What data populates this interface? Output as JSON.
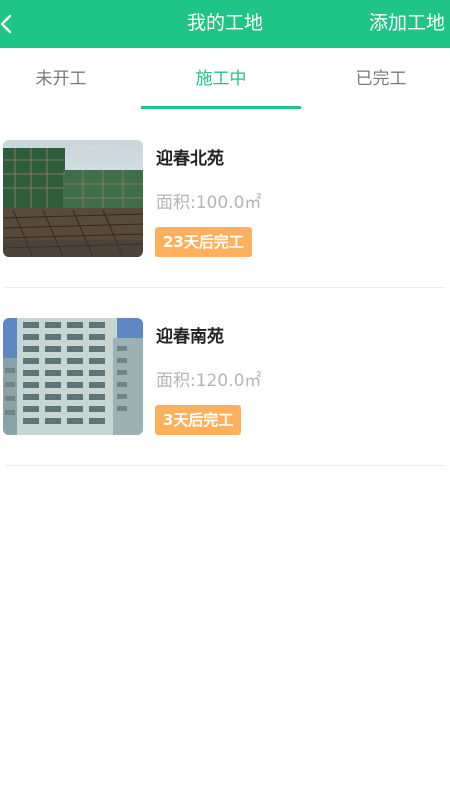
{
  "header": {
    "title": "我的工地",
    "add_label": "添加工地",
    "background": "#1fc586",
    "back_icon": "chevron-left-icon"
  },
  "tabs": [
    {
      "label": "未开工",
      "active": false
    },
    {
      "label": "施工中",
      "active": true
    },
    {
      "label": "已完工",
      "active": false
    }
  ],
  "accent_color": "#1fc586",
  "badge_color": "#ffb05c",
  "sites": [
    {
      "name": "迎春北苑",
      "area": "面积:100.0㎡",
      "badge": "23天后完工",
      "image": "construction-site-photo"
    },
    {
      "name": "迎春南苑",
      "area": "面积:120.0㎡",
      "badge": "3天后完工",
      "image": "apartment-building-photo"
    }
  ]
}
